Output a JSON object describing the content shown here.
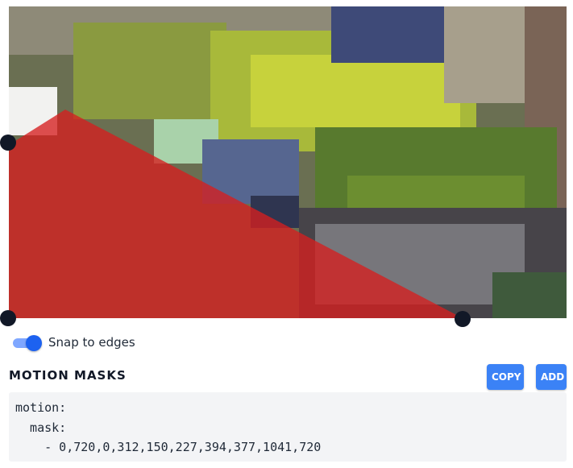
{
  "camera": {
    "description_icon": "camera-snapshot"
  },
  "mask_editor": {
    "fill_color": "#d61f1f",
    "fill_opacity": 0.78
  },
  "snap_toggle": {
    "label": "Snap to edges",
    "enabled": true,
    "accent_color": "#1d62f0"
  },
  "section": {
    "title": "MOTION MASKS",
    "copy_label": "COPY",
    "add_label": "ADD",
    "button_color": "#3b82f6"
  },
  "config": {
    "line1": "motion:",
    "line2": "  mask:",
    "line3": "    - 0,720,0,312,150,227,394,377,1041,720"
  }
}
